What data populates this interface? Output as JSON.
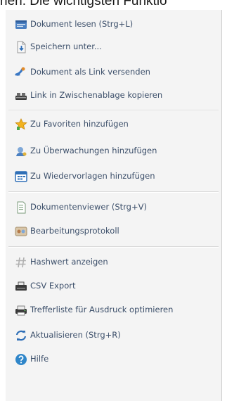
{
  "top_text": "hen. Die wichtigsten Funktio",
  "menu": {
    "items": [
      {
        "label": "Dokument lesen (Strg+L)",
        "icon": "document-read-icon"
      },
      {
        "label": "Speichern unter...",
        "icon": "save-as-icon"
      },
      {
        "label": "Dokument als Link versenden",
        "icon": "send-link-icon"
      },
      {
        "label": "Link in Zwischenablage kopieren",
        "icon": "clipboard-link-icon"
      },
      {
        "label": "Zu Favoriten hinzufügen",
        "icon": "star-icon"
      },
      {
        "label": "Zu Überwachungen hinzufügen",
        "icon": "watch-icon"
      },
      {
        "label": "Zu Wiedervorlagen hinzufügen",
        "icon": "calendar-icon"
      },
      {
        "label": "Dokumentenviewer (Strg+V)",
        "icon": "viewer-icon"
      },
      {
        "label": "Bearbeitungsprotokoll",
        "icon": "protocol-icon"
      },
      {
        "label": "Hashwert anzeigen",
        "icon": "hash-icon"
      },
      {
        "label": "CSV Export",
        "icon": "csv-export-icon"
      },
      {
        "label": "Trefferliste für Ausdruck optimieren",
        "icon": "printer-icon"
      },
      {
        "label": "Aktualisieren (Strg+R)",
        "icon": "refresh-icon"
      },
      {
        "label": "Hilfe",
        "icon": "help-icon"
      }
    ]
  }
}
